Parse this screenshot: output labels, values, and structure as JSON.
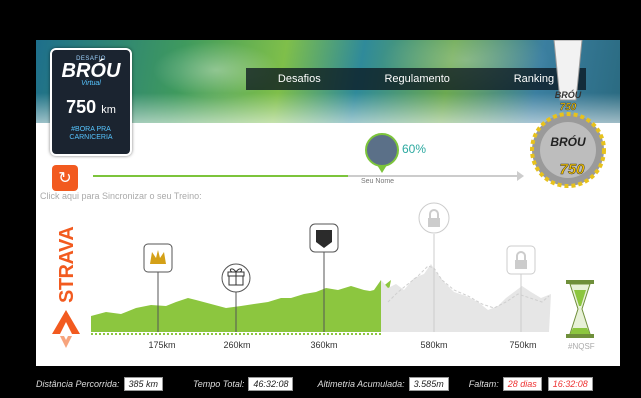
{
  "nav": {
    "items": [
      "Desafios",
      "Regulamento",
      "Ranking"
    ]
  },
  "badge": {
    "label": "DESAFIO",
    "logo": "BRÓU",
    "subtitle": "Virtual",
    "distance": "750",
    "unit": "km",
    "tag_line1": "#BORA PRA",
    "tag_line2": "CARNICERIA"
  },
  "medal": {
    "logo": "BRÓU",
    "number": "750"
  },
  "progress": {
    "percent_text": "60%",
    "percent": 0.6,
    "user_name": "Seu Nome"
  },
  "sync": {
    "hint": "Click aqui para Sincronizar o seu Treino:"
  },
  "strava": {
    "label": "STRAVA"
  },
  "elevation": {
    "checkpoints": [
      {
        "km": "175km",
        "icon": "crown-icon",
        "state": "done"
      },
      {
        "km": "260km",
        "icon": "gift-icon",
        "state": "done"
      },
      {
        "km": "360km",
        "icon": "bro-badge-icon",
        "state": "done"
      },
      {
        "km": "580km",
        "icon": "lock-icon",
        "state": "locked"
      },
      {
        "km": "750km",
        "icon": "lock-icon",
        "state": "locked"
      }
    ],
    "completed_color": "#8cc63f",
    "remaining_color": "#e6e6e6"
  },
  "hourglass_tag": "#NQSF",
  "stats": {
    "distance_label": "Distância Percorrida:",
    "distance_value": "385 km",
    "time_label": "Tempo Total:",
    "time_value": "46:32:08",
    "altimetry_label": "Altimetria Acumulada:",
    "altimetry_value": "3.585m",
    "remaining_label": "Faltam:",
    "remaining_days": "28 dias",
    "remaining_time": "16:32:08"
  }
}
